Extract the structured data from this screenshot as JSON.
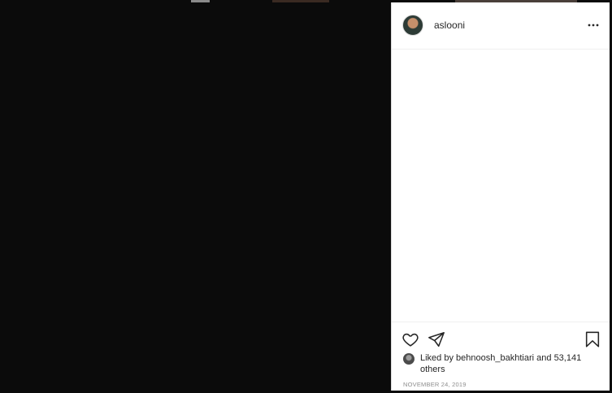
{
  "post": {
    "author": {
      "username": "aslooni"
    },
    "likes": {
      "prefix": "Liked by",
      "liker": "behnoosh_bakhtiari",
      "conjunction": "and",
      "others": "53,141 others"
    },
    "date": "NOVEMBER 24, 2019"
  },
  "icons": {
    "more": "more-options-icon",
    "like": "heart-icon",
    "share": "share-icon",
    "save": "bookmark-icon"
  }
}
